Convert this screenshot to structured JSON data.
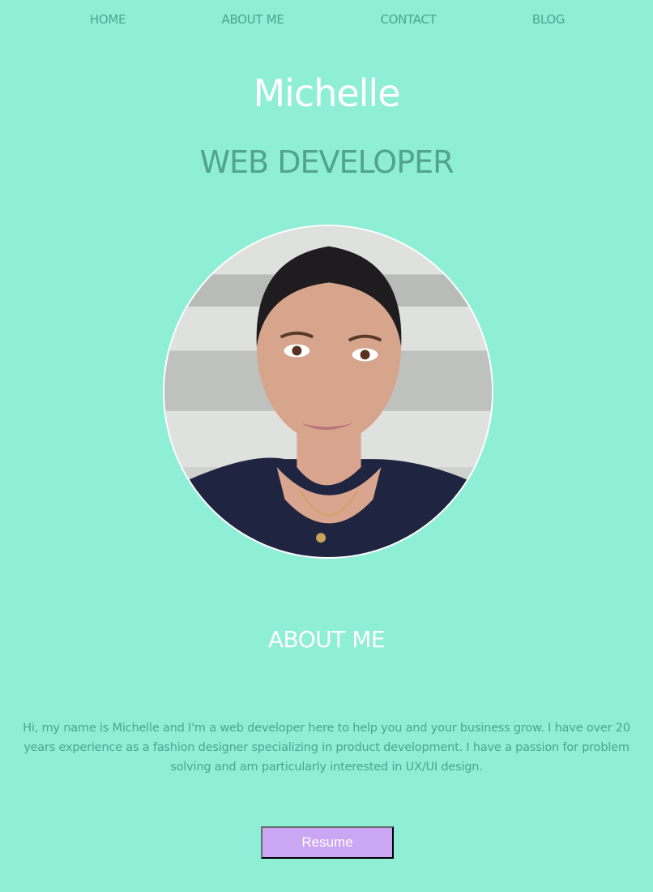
{
  "nav": {
    "items": [
      {
        "label": "HOME"
      },
      {
        "label": "ABOUT ME"
      },
      {
        "label": "CONTACT"
      },
      {
        "label": "BLOG"
      }
    ]
  },
  "hero": {
    "name": "Michelle",
    "role": "WEB DEVELOPER"
  },
  "about": {
    "heading": "ABOUT ME",
    "body": "Hi, my name is Michelle and I'm a web developer here to help you and your business grow. I have over 20 years experience as a fashion designer specializing in product development. I have a passion for problem solving and am particularly interested in UX/UI design."
  },
  "resume": {
    "label": "Resume"
  },
  "colors": {
    "background": "#8eeed6",
    "accent_text": "#4ea48f",
    "button": "#cba6f2"
  }
}
